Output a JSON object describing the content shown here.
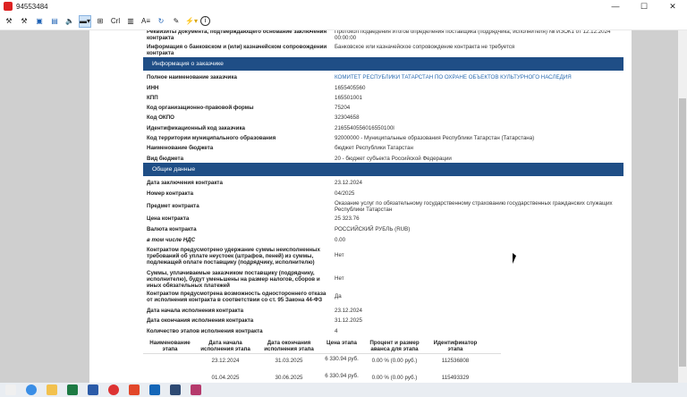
{
  "window": {
    "title": "94553484",
    "minimize": "—",
    "maximize": "☐",
    "close": "✕"
  },
  "toolbar": {
    "crl": "Crl",
    "aa": "A≡"
  },
  "top_rows": [
    {
      "label": "Реквизиты документа, подтверждающего основание заключения контракта",
      "value": "Протокол подведения итогов определения поставщика (подрядчика, исполнителя) № ИЗОК1 от 12.12.2024 00:00:00"
    },
    {
      "label": "Информация о банковском и (или) казначейском сопровождении контракта",
      "value": "Банковское или казначейское сопровождение контракта не требуется"
    }
  ],
  "sections": {
    "customer": "Информация о заказчике",
    "general": "Общие данные"
  },
  "customer_rows": [
    {
      "label": "Полное наименование заказчика",
      "value": "КОМИТЕТ РЕСПУБЛИКИ ТАТАРСТАН ПО ОХРАНЕ ОБЪЕКТОВ КУЛЬТУРНОГО НАСЛЕДИЯ"
    },
    {
      "label": "ИНН",
      "value": "1655405560"
    },
    {
      "label": "КПП",
      "value": "165501001"
    },
    {
      "label": "Код организационно-правовой формы",
      "value": "75204"
    },
    {
      "label": "Код ОКПО",
      "value": "32304658"
    },
    {
      "label": "Идентификационный код заказчика",
      "value": "2165540556016550100l"
    },
    {
      "label": "Код территории муниципального образования",
      "value": "92000000 - Муниципальные образования Республики Татарстан (Татарстана)"
    },
    {
      "label": "Наименование бюджета",
      "value": "бюджет Республики Татарстан"
    },
    {
      "label": "Вид бюджета",
      "value": "20 - бюджет субъекта Российской Федерации"
    }
  ],
  "general_rows": [
    {
      "label": "Дата заключения контракта",
      "value": "23.12.2024"
    },
    {
      "label": "Номер контракта",
      "value": "04/2025"
    },
    {
      "label": "Предмет контракта",
      "value": "Оказание услуг по обязательному государственному страхованию государственных гражданских служащих Республики Татарстан"
    },
    {
      "label": "Цена контракта",
      "value": "25 323.76"
    },
    {
      "label": "Валюта контракта",
      "value": "РОССИЙСКИЙ РУБЛЬ (RUB)"
    },
    {
      "label": "в том числе НДС",
      "value": "0.00"
    },
    {
      "label": "Контрактом предусмотрено удержание суммы неисполненных требований об уплате неустоек (штрафов, пеней) из суммы, подлежащей оплате поставщику (подрядчику, исполнителю)",
      "value": "Нет"
    },
    {
      "label": "Суммы, уплачиваемые заказчиком поставщику (подрядчику, исполнителю), будут уменьшены на размер налогов, сборов и иных обязательных платежей",
      "value": "Нет"
    },
    {
      "label": "Контрактом предусмотрена возможность одностороннего отказа от исполнения контракта в соответствии со ст. 95 Закона 44-ФЗ",
      "value": "Да"
    },
    {
      "label": "Дата начала исполнения контракта",
      "value": "23.12.2024"
    },
    {
      "label": "Дата окончания исполнения контракта",
      "value": "31.12.2025"
    },
    {
      "label": "Количество этапов исполнения контракта",
      "value": "4"
    }
  ],
  "stages": {
    "headers": [
      "Наименование этапа",
      "Дата начала исполнения этапа",
      "Дата окончания исполнения этапа",
      "Цена этапа",
      "Процент и размер аванса для этапа",
      "Идентификатор этапа"
    ],
    "rows": [
      {
        "start": "23.12.2024",
        "end": "31.03.2025",
        "price": "6 330.94 руб.",
        "advance": "0.00 % (0.00 руб.)",
        "id": "112536808"
      },
      {
        "start": "01.04.2025",
        "end": "30.06.2025",
        "price": "6 330.94 руб.",
        "advance": "0.00 % (0.00 руб.)",
        "id": "115493329"
      }
    ]
  },
  "colors": {
    "section_bg": "#1f4e86",
    "link": "#2a6bb0",
    "side": "#cfcfcf"
  }
}
